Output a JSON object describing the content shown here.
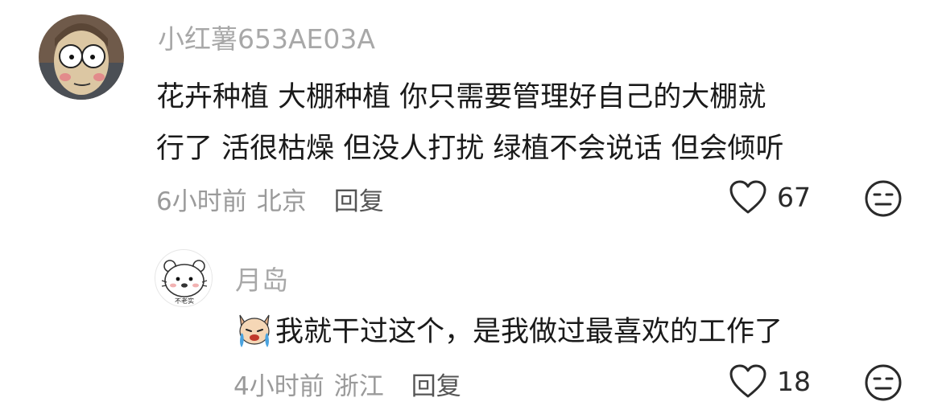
{
  "comments": [
    {
      "username": "小红薯653AE03A",
      "text_lines": [
        "花卉种植 大棚种植 你只需要管理好自己的大棚就",
        "行了 活很枯燥 但没人打扰 绿植不会说话 但会倾听"
      ],
      "time": "6小时前",
      "location": "北京",
      "reply_label": "回复",
      "like_count": "67"
    },
    {
      "username": "月岛",
      "text": "我就干过这个，是我做过最喜欢的工作了",
      "sticker_icon": "crying-dog-sticker",
      "time": "4小时前",
      "location": "浙江",
      "reply_label": "回复",
      "like_count": "18",
      "avatar_caption": "不老实"
    }
  ],
  "icons": {
    "like": "heart-icon",
    "dislike": "neutral-face-icon"
  }
}
